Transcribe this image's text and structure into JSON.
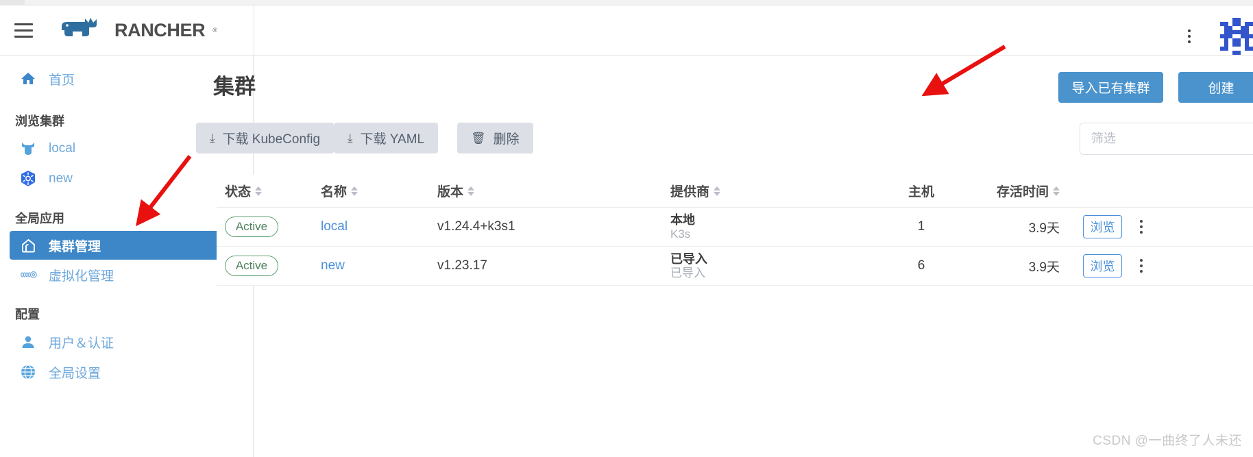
{
  "app": {
    "brand_name": "RANCHER",
    "brand_tm": "®",
    "menu_icon": "hamburger-icon",
    "header_kebab_icon": "vertical-dots-icon",
    "avatar_icon": "user-avatar-tile"
  },
  "sidebar": {
    "home": {
      "label": "首页",
      "icon": "home-icon"
    },
    "groups": [
      {
        "title": "浏览集群",
        "items": [
          {
            "label": "local",
            "icon": "rancher-cow-icon",
            "selected": false
          },
          {
            "label": "new",
            "icon": "kubernetes-icon",
            "selected": false
          }
        ]
      },
      {
        "title": "全局应用",
        "items": [
          {
            "label": "集群管理",
            "icon": "cluster-management-icon",
            "selected": true
          },
          {
            "label": "虚拟化管理",
            "icon": "virtualization-icon",
            "selected": false
          }
        ]
      },
      {
        "title": "配置",
        "items": [
          {
            "label": "用户＆认证",
            "icon": "user-icon",
            "selected": false
          },
          {
            "label": "全局设置",
            "icon": "globe-icon",
            "selected": false
          }
        ]
      }
    ]
  },
  "main": {
    "page_title": "集群",
    "buttons": {
      "import_label": "导入已有集群",
      "create_label": "创建"
    },
    "toolbar": [
      {
        "label": "下载 KubeConfig",
        "icon": "download-icon"
      },
      {
        "label": "下载 YAML",
        "icon": "download-icon"
      },
      {
        "label": "删除",
        "icon": "trash-icon"
      }
    ],
    "filter": {
      "placeholder": "筛选",
      "value": ""
    },
    "table": {
      "columns": [
        {
          "label": "状态",
          "sortable": true
        },
        {
          "label": "名称",
          "sortable": true
        },
        {
          "label": "版本",
          "sortable": true
        },
        {
          "label": "提供商",
          "sortable": true
        },
        {
          "label": "主机",
          "sortable": false
        },
        {
          "label": "存活时间",
          "sortable": true
        },
        {
          "label": "",
          "sortable": false
        }
      ],
      "rows": [
        {
          "state": "Active",
          "name": "local",
          "version": "v1.24.4+k3s1",
          "provider_main": "本地",
          "provider_sub": "K3s",
          "hosts": "1",
          "age": "3.9天",
          "explore_label": "浏览",
          "kebab_icon": "vertical-dots-icon"
        },
        {
          "state": "Active",
          "name": "new",
          "version": "v1.23.17",
          "provider_main": "已导入",
          "provider_sub": "已导入",
          "hosts": "6",
          "age": "3.9天",
          "explore_label": "浏览",
          "kebab_icon": "vertical-dots-icon"
        }
      ]
    }
  },
  "watermark": {
    "text": "CSDN @一曲终了人未还"
  },
  "colors": {
    "brand_blue": "#2f6f9f",
    "accent_blue": "#4a93cc",
    "link_blue": "#4a90d9",
    "selected_nav": "#3d87c8",
    "active_green": "#5d9e6e",
    "annotation_red": "#e8110f"
  },
  "annotations": [
    {
      "name": "arrow-to-import-button"
    },
    {
      "name": "arrow-to-cluster-management"
    }
  ]
}
